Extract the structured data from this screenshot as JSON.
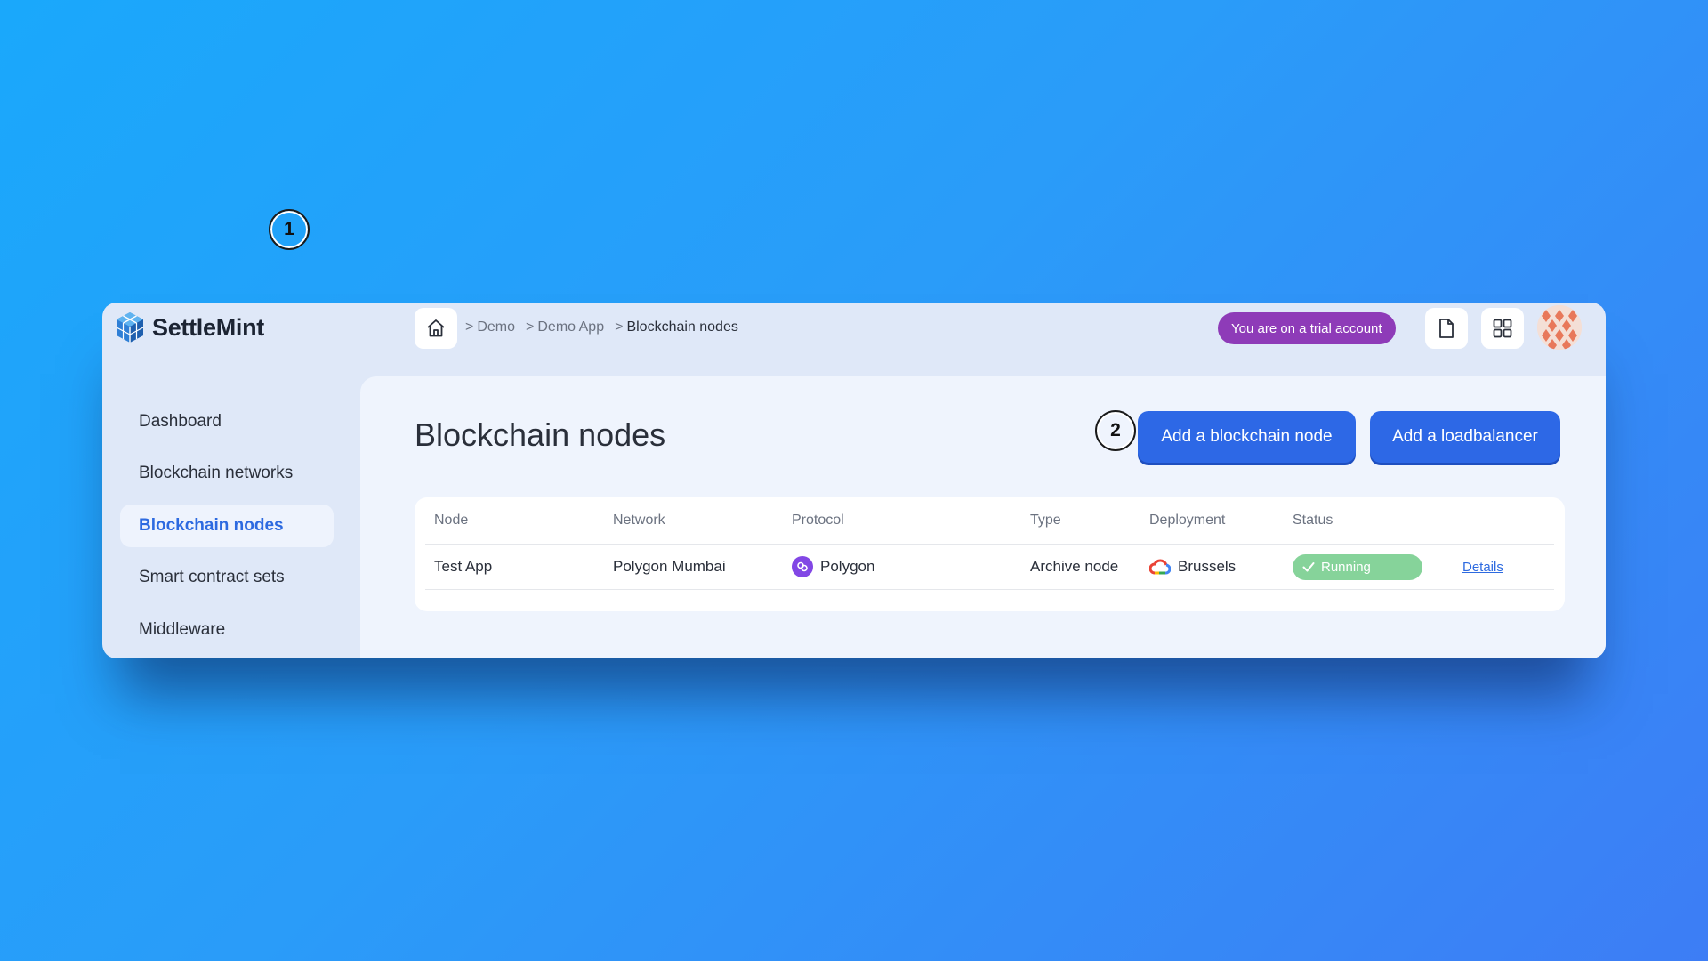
{
  "brand": {
    "name": "SettleMint"
  },
  "breadcrumb": {
    "items": [
      {
        "sep": ">",
        "label": "Demo"
      },
      {
        "sep": ">",
        "label": "Demo App"
      },
      {
        "sep": ">",
        "label": "Blockchain nodes"
      }
    ]
  },
  "header": {
    "trial_label": "You are on a trial account"
  },
  "sidebar": {
    "items": [
      {
        "label": "Dashboard"
      },
      {
        "label": "Blockchain networks"
      },
      {
        "label": "Blockchain nodes",
        "active": true
      },
      {
        "label": "Smart contract sets"
      },
      {
        "label": "Middleware"
      }
    ]
  },
  "markers": {
    "one": "1",
    "two": "2"
  },
  "main": {
    "title": "Blockchain nodes",
    "add_node_label": "Add a blockchain node",
    "add_lb_label": "Add a loadbalancer"
  },
  "table": {
    "columns": [
      "Node",
      "Network",
      "Protocol",
      "Type",
      "Deployment",
      "Status"
    ],
    "rows": [
      {
        "node": "Test App",
        "network": "Polygon Mumbai",
        "protocol": "Polygon",
        "type": "Archive node",
        "deployment": "Brussels",
        "status": "Running",
        "details": "Details"
      }
    ]
  },
  "colors": {
    "accent": "#2d68e6",
    "trial_badge": "#8e3bb8",
    "running": "#86d39a",
    "polygon": "#8247e5"
  },
  "icons": [
    "settlemint-logo-icon",
    "home-icon",
    "document-icon",
    "grid-icon",
    "avatar",
    "polygon-icon",
    "google-cloud-icon",
    "check-icon"
  ]
}
